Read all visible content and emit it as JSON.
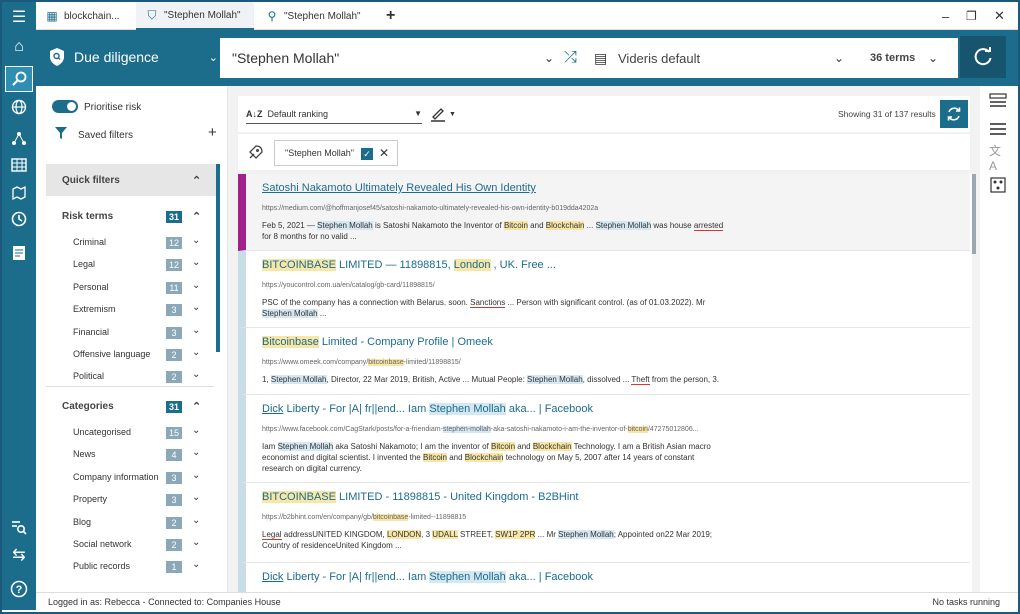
{
  "tabs": [
    {
      "label": "blockchain..."
    },
    {
      "label": "\"Stephen Mollah\""
    },
    {
      "label": "\"Stephen Mollah\""
    }
  ],
  "searchbar": {
    "mode": "Due diligence",
    "query": "\"Stephen Mollah\"",
    "profile": "Videris default",
    "terms": "36 terms"
  },
  "sidebar": {
    "prioritise_label": "Prioritise risk",
    "saved_filters_label": "Saved filters",
    "quick_filters_label": "Quick filters",
    "risk_terms": {
      "label": "Risk terms",
      "count": "31",
      "items": [
        {
          "label": "Criminal",
          "count": "12"
        },
        {
          "label": "Legal",
          "count": "12"
        },
        {
          "label": "Personal",
          "count": "11"
        },
        {
          "label": "Extremism",
          "count": "3"
        },
        {
          "label": "Financial",
          "count": "3"
        },
        {
          "label": "Offensive language",
          "count": "2"
        },
        {
          "label": "Political",
          "count": "2"
        }
      ]
    },
    "categories": {
      "label": "Categories",
      "count": "31",
      "items": [
        {
          "label": "Uncategorised",
          "count": "15"
        },
        {
          "label": "News",
          "count": "4"
        },
        {
          "label": "Company information",
          "count": "3"
        },
        {
          "label": "Property",
          "count": "3"
        },
        {
          "label": "Blog",
          "count": "2"
        },
        {
          "label": "Social network",
          "count": "2"
        },
        {
          "label": "Public records",
          "count": "1"
        }
      ]
    }
  },
  "toolbar": {
    "ranking": "Default ranking",
    "showing": "Showing 31 of 137 results"
  },
  "chip": {
    "label": "\"Stephen Mollah\""
  },
  "results": [
    {
      "title": "Satoshi Nakamoto Ultimately Revealed His Own Identity",
      "url": "https://medium.com/@hoffmanjosef45/satoshi-nakamoto-ultimately-revealed-his-own-identity-b019dda4202a"
    },
    {
      "title": "BITCOINBASE LIMITED — 11898815, London , UK. Free ...",
      "url": "https://youcontrol.com.ua/en/catalog/gb-card/11898815/"
    },
    {
      "title": "Bitcoinbase Limited - Company Profile | Omeek",
      "url": "https://www.omeek.com/company/bitcoinbase-limited/11898815/"
    },
    {
      "title": "Dick Liberty - For |A| fr||end... Iam Stephen Mollah aka... | Facebook",
      "url": "https://www.facebook.com/CagStark/posts/for-a-friendiam-stephen-mollah-aka-satoshi-nakamoto-i-am-the-inventor-of-bitcoin/47275012806..."
    },
    {
      "title": "BITCOINBASE LIMITED - 11898815 - United Kingdom - B2BHint",
      "url": "https://b2bhint.com/en/company/gb/bitcoinbase-limited--11898815"
    },
    {
      "title": "Dick Liberty - For |A| fr||end... Iam Stephen Mollah aka... | Facebook"
    }
  ],
  "status": {
    "left": "Logged in as: Rebecca - Connected to: Companies House",
    "right": "No tasks running"
  }
}
